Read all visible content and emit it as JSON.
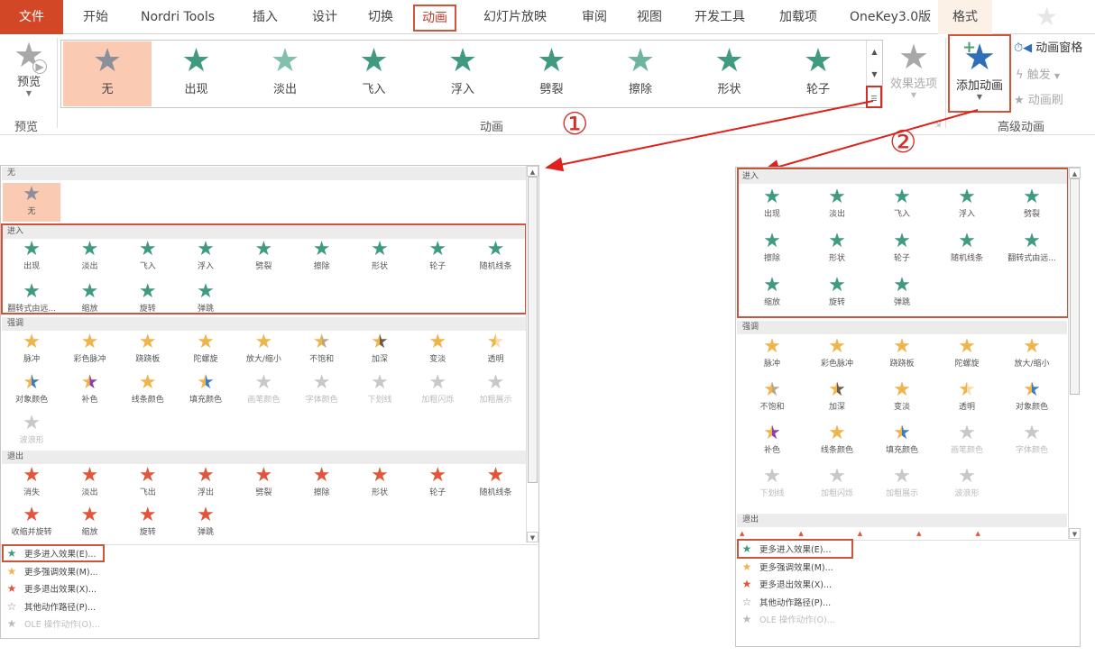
{
  "tabs": {
    "file": "文件",
    "items": [
      "开始",
      "Nordri Tools",
      "插入",
      "设计",
      "切换",
      "动画",
      "幻灯片放映",
      "审阅",
      "视图",
      "开发工具",
      "加载项",
      "OneKey3.0版",
      "格式"
    ],
    "active": "动画"
  },
  "ribbon": {
    "preview": {
      "label": "预览",
      "group": "预览"
    },
    "gallery": [
      {
        "label": "无",
        "color": "#8a8f99",
        "selected": true
      },
      {
        "label": "出现",
        "color": "#3f9a80"
      },
      {
        "label": "淡出",
        "color": "#82c0ad"
      },
      {
        "label": "飞入",
        "color": "#3f9a80"
      },
      {
        "label": "浮入",
        "color": "#3f9a80"
      },
      {
        "label": "劈裂",
        "color": "#3f9a80"
      },
      {
        "label": "擦除",
        "color": "#6fb59e"
      },
      {
        "label": "形状",
        "color": "#3f9a80"
      },
      {
        "label": "轮子",
        "color": "#3f9a80"
      }
    ],
    "animation_group": "动画",
    "effect_options": "效果选项",
    "add_animation": "添加动画",
    "animation_pane": "动画窗格",
    "trigger": "触发",
    "animation_painter": "动画刷",
    "advanced_group": "高级动画"
  },
  "annotations": {
    "one": "①",
    "two": "②"
  },
  "colors": {
    "entrance": "#3f9a80",
    "emphasis": "#f0b44c",
    "exit": "#e0563a",
    "disabled": "#c8c8c8",
    "highlight": "#c9563c"
  },
  "left_panel": {
    "none_header": "无",
    "none_item": "无",
    "entrance_header": "进入",
    "entrance": [
      "出现",
      "淡出",
      "飞入",
      "浮入",
      "劈裂",
      "擦除",
      "形状",
      "轮子",
      "随机线条",
      "翻转式由远...",
      "缩放",
      "旋转",
      "弹跳"
    ],
    "emphasis_header": "强调",
    "emphasis": [
      {
        "l": "脉冲"
      },
      {
        "l": "彩色脉冲"
      },
      {
        "l": "跷跷板"
      },
      {
        "l": "陀螺旋"
      },
      {
        "l": "放大/缩小"
      },
      {
        "l": "不饱和",
        "c2": "#b8a88a"
      },
      {
        "l": "加深",
        "c2": "#6b5a45"
      },
      {
        "l": "变淡"
      },
      {
        "l": "透明",
        "c2": "#f7dcae"
      },
      {
        "l": "对象颜色",
        "c2": "#3b7dc4"
      },
      {
        "l": "补色",
        "c2": "#8a3fb0"
      },
      {
        "l": "线条颜色"
      },
      {
        "l": "填充颜色",
        "c2": "#3b7dc4"
      },
      {
        "l": "画笔颜色",
        "d": true
      },
      {
        "l": "字体颜色",
        "d": true
      },
      {
        "l": "下划线",
        "d": true
      },
      {
        "l": "加粗闪烁",
        "d": true
      },
      {
        "l": "加粗展示",
        "d": true
      },
      {
        "l": "波浪形",
        "d": true
      }
    ],
    "exit_header": "退出",
    "exit": [
      "消失",
      "淡出",
      "飞出",
      "浮出",
      "劈裂",
      "擦除",
      "形状",
      "轮子",
      "随机线条",
      "收缩并旋转",
      "缩放",
      "旋转",
      "弹跳"
    ]
  },
  "right_panel": {
    "entrance_header": "进入",
    "entrance": [
      "出现",
      "淡出",
      "飞入",
      "浮入",
      "劈裂",
      "擦除",
      "形状",
      "轮子",
      "随机线条",
      "翻转式由远...",
      "缩放",
      "旋转",
      "弹跳"
    ],
    "emphasis_header": "强调",
    "emphasis": [
      {
        "l": "脉冲"
      },
      {
        "l": "彩色脉冲"
      },
      {
        "l": "跷跷板"
      },
      {
        "l": "陀螺旋"
      },
      {
        "l": "放大/缩小"
      },
      {
        "l": "不饱和",
        "c2": "#b8a88a"
      },
      {
        "l": "加深",
        "c2": "#6b5a45"
      },
      {
        "l": "变淡"
      },
      {
        "l": "透明",
        "c2": "#f7dcae"
      },
      {
        "l": "对象颜色",
        "c2": "#3b7dc4"
      },
      {
        "l": "补色",
        "c2": "#8a3fb0"
      },
      {
        "l": "线条颜色"
      },
      {
        "l": "填充颜色",
        "c2": "#3b7dc4"
      },
      {
        "l": "画笔颜色",
        "d": true
      },
      {
        "l": "字体颜色",
        "d": true
      },
      {
        "l": "下划线",
        "d": true
      },
      {
        "l": "加粗闪烁",
        "d": true
      },
      {
        "l": "加粗展示",
        "d": true
      },
      {
        "l": "波浪形",
        "d": true
      }
    ],
    "exit_header": "退出"
  },
  "menu": [
    {
      "label": "更多进入效果(E)...",
      "color": "#3f9a80"
    },
    {
      "label": "更多强调效果(M)...",
      "color": "#f0b44c"
    },
    {
      "label": "更多退出效果(X)...",
      "color": "#e0563a"
    },
    {
      "label": "其他动作路径(P)...",
      "color": "#888",
      "outline": true
    },
    {
      "label": "OLE 操作动作(O)...",
      "color": "#bbb",
      "disabled": true
    }
  ]
}
